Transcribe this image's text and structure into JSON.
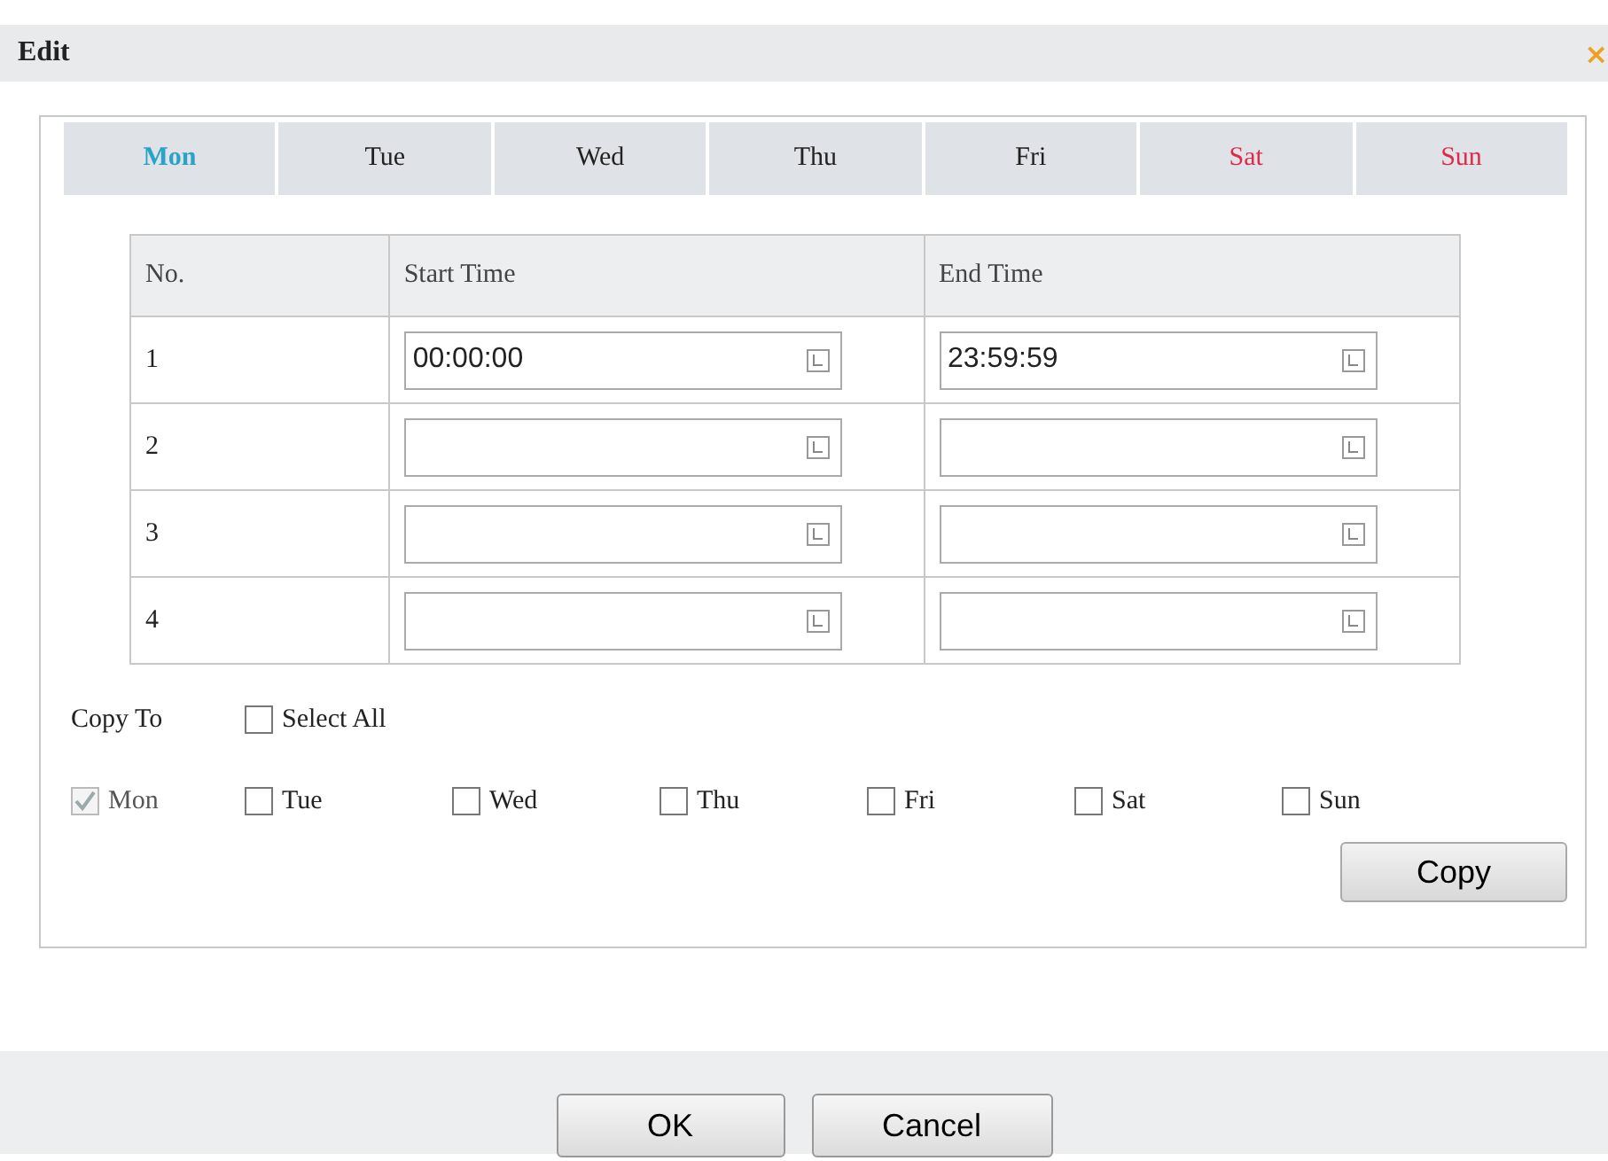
{
  "window": {
    "title": "Edit",
    "close": "×"
  },
  "tabs": [
    {
      "label": "Mon",
      "selected": true,
      "kind": "weekday"
    },
    {
      "label": "Tue",
      "selected": false,
      "kind": "weekday"
    },
    {
      "label": "Wed",
      "selected": false,
      "kind": "weekday"
    },
    {
      "label": "Thu",
      "selected": false,
      "kind": "weekday"
    },
    {
      "label": "Fri",
      "selected": false,
      "kind": "weekday"
    },
    {
      "label": "Sat",
      "selected": false,
      "kind": "weekend"
    },
    {
      "label": "Sun",
      "selected": false,
      "kind": "weekend"
    }
  ],
  "table": {
    "columns": [
      "No.",
      "Start Time",
      "End Time"
    ],
    "rows": [
      {
        "no": "1",
        "start": "00:00:00",
        "end": "23:59:59"
      },
      {
        "no": "2"
      },
      {
        "no": "3"
      },
      {
        "no": "4"
      }
    ]
  },
  "copy_to": {
    "label": "Copy To",
    "select_all": {
      "label": "Select All",
      "checked": false
    },
    "days": [
      {
        "label": "Mon",
        "checked": true,
        "disabled": true
      },
      {
        "label": "Tue",
        "checked": false,
        "disabled": false
      },
      {
        "label": "Wed",
        "checked": false,
        "disabled": false
      },
      {
        "label": "Thu",
        "checked": false,
        "disabled": false
      },
      {
        "label": "Fri",
        "checked": false,
        "disabled": false
      },
      {
        "label": "Sat",
        "checked": false,
        "disabled": false
      },
      {
        "label": "Sun",
        "checked": false,
        "disabled": false
      }
    ],
    "button": "Copy"
  },
  "buttons": [
    "OK",
    "Cancel"
  ]
}
